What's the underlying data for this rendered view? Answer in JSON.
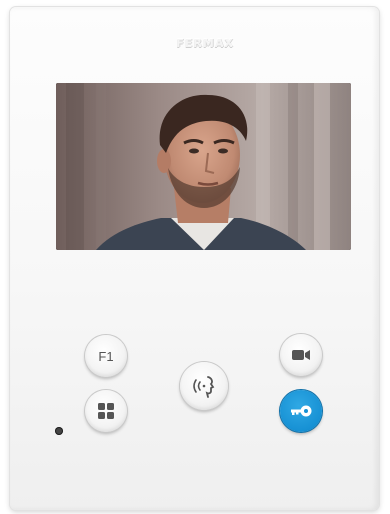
{
  "device": {
    "brand": "FERMAX"
  },
  "buttons": {
    "f1": {
      "label": "F1",
      "icon": "f1-text"
    },
    "menu": {
      "icon": "grid-icon"
    },
    "talk": {
      "icon": "speaking-head-icon"
    },
    "camera": {
      "icon": "video-camera-icon"
    },
    "door": {
      "icon": "key-icon",
      "color": "#1791d4"
    }
  },
  "colors": {
    "body": "#f7f7f7",
    "accent": "#1791d4",
    "icon": "#555555"
  }
}
